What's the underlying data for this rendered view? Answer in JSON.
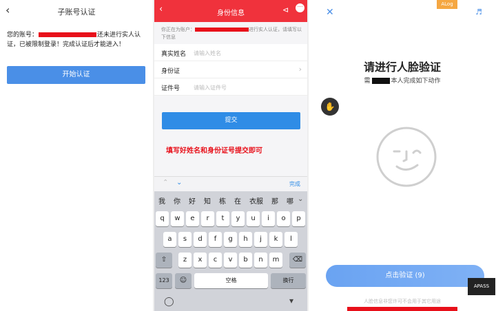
{
  "panel1": {
    "title": "子账号认证",
    "back_icon": "chevron-left-icon",
    "message_prefix": "您的账号：",
    "message_suffix": "还未进行实人认证，已被限制登录！完成认证后才能进入！",
    "start_button": "开始认证"
  },
  "panel2": {
    "header_title": "身份信息",
    "header_color": "#f0323c",
    "notice_prefix": "你正在为账户：",
    "notice_suffix": "进行实人认证，请填写以下信息",
    "fields": [
      {
        "label": "真实姓名",
        "placeholder": "请输入姓名"
      },
      {
        "label": "身份证",
        "placeholder": ""
      },
      {
        "label": "证件号",
        "placeholder": "请输入证件号"
      }
    ],
    "submit_button": "提交",
    "hint": "填写好姓名和身份证号提交即可",
    "done_label": "完成",
    "candidates": [
      "我",
      "你",
      "好",
      "知",
      "栋",
      "在",
      "衣服",
      "那",
      "哪"
    ],
    "row1": [
      "q",
      "w",
      "e",
      "r",
      "t",
      "y",
      "u",
      "i",
      "o",
      "p"
    ],
    "row2": [
      "a",
      "s",
      "d",
      "f",
      "g",
      "h",
      "j",
      "k",
      "l"
    ],
    "row3": [
      "z",
      "x",
      "c",
      "v",
      "b",
      "n",
      "m"
    ],
    "key_123": "123",
    "key_space": "空格",
    "key_return": "换行"
  },
  "panel3": {
    "alog": "ALog",
    "title": "请进行人脸验证",
    "subtitle_prefix": "需",
    "subtitle_suffix": "本人完成如下动作",
    "verify_button": "点击验证 (9)",
    "apass": "APASS",
    "footer": "人脸信息非您许可不会用于其它用途",
    "accent_color": "#4a8fe7"
  }
}
